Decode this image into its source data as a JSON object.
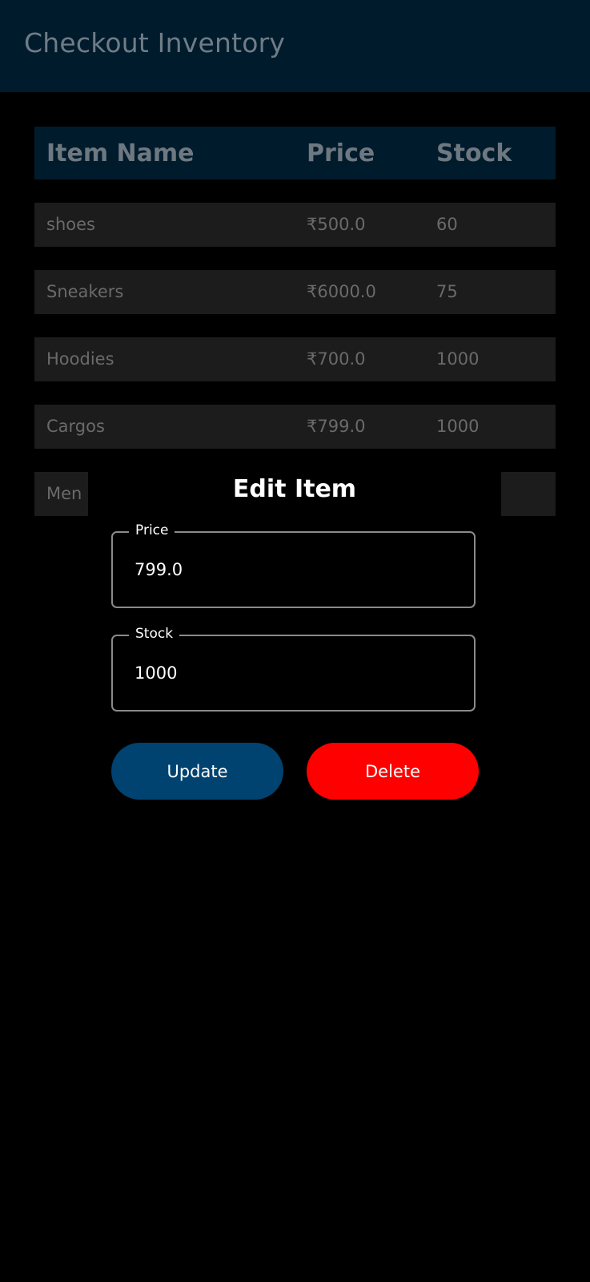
{
  "app": {
    "title": "Checkout Inventory"
  },
  "table": {
    "headers": [
      "Item Name",
      "Price",
      "Stock"
    ],
    "rows": [
      {
        "name": "shoes",
        "price": "₹500.0",
        "stock": "60"
      },
      {
        "name": "Sneakers",
        "price": "₹6000.0",
        "stock": "75"
      },
      {
        "name": "Hoodies",
        "price": "₹700.0",
        "stock": "1000"
      },
      {
        "name": "Cargos",
        "price": "₹799.0",
        "stock": "1000"
      },
      {
        "name": "Men a",
        "price": "",
        "stock": ""
      }
    ]
  },
  "dialog": {
    "title": "Edit Item",
    "price_label": "Price",
    "price_value": "799.0",
    "stock_label": "Stock",
    "stock_value": "1000",
    "update_label": "Update",
    "delete_label": "Delete"
  },
  "colors": {
    "app_bar": "#001B2C",
    "row_background": "#1C1C1C",
    "update_button": "#004270",
    "delete_button": "#FF0000"
  }
}
